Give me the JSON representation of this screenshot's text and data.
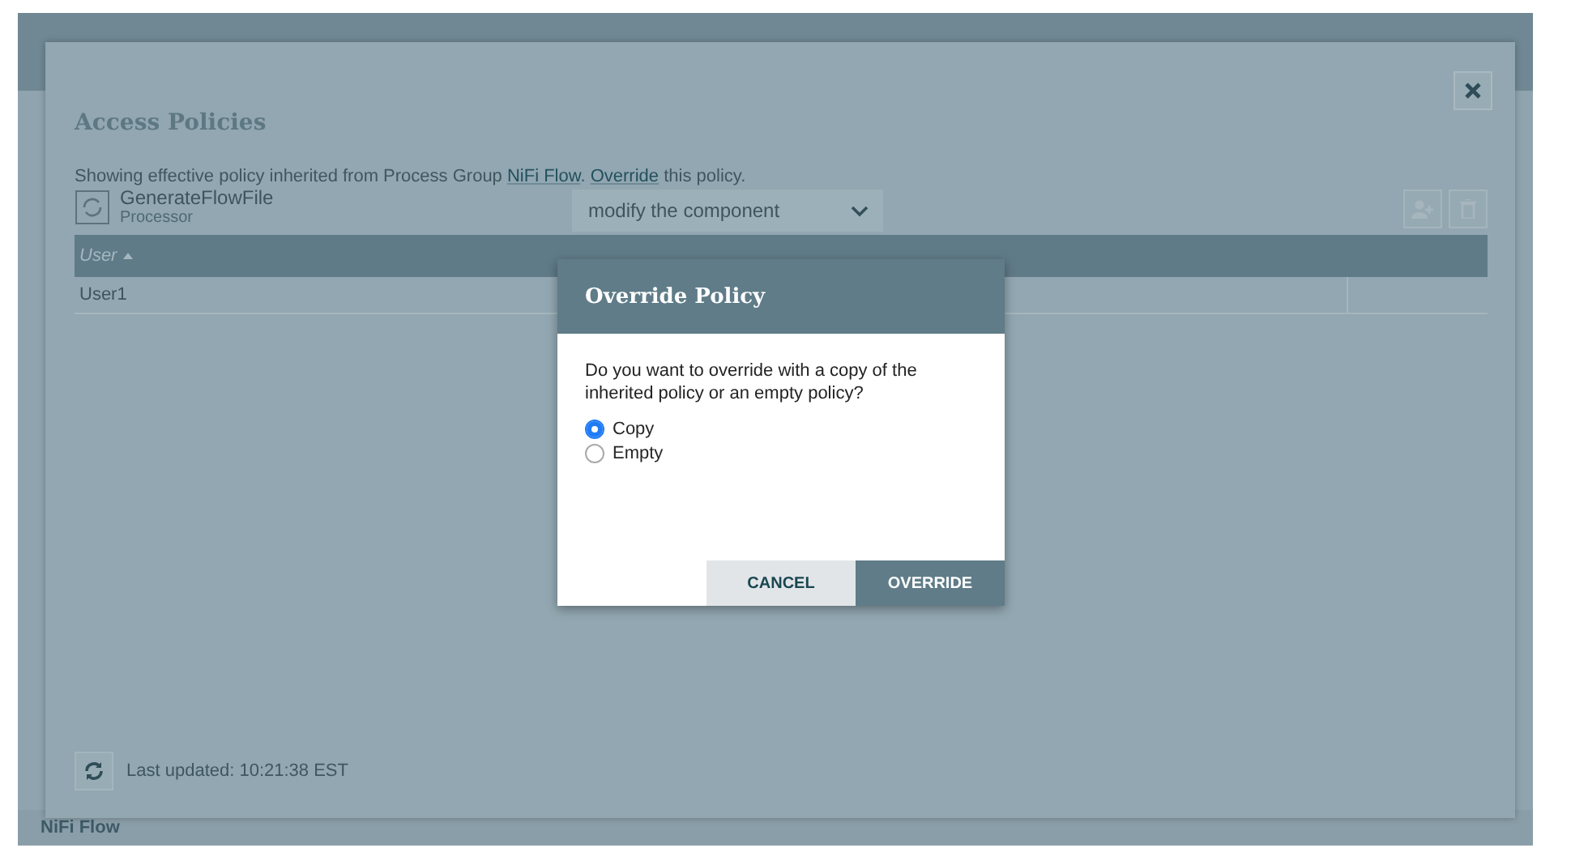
{
  "app": {
    "breadcrumb": "NiFi Flow"
  },
  "access_policies": {
    "title": "Access Policies",
    "notice": {
      "before": "Showing effective policy inherited from Process Group ",
      "group_link": "NiFi Flow",
      "middle": ". ",
      "override_link": "Override",
      "after": " this policy."
    },
    "component": {
      "name": "GenerateFlowFile",
      "type": "Processor"
    },
    "action": {
      "value": "modify the component"
    },
    "table": {
      "columns": [
        {
          "label": "User",
          "sort_ascending": true
        }
      ],
      "rows": [
        {
          "user": "User1"
        }
      ]
    },
    "last_updated": "Last updated: 10:21:38 EST"
  },
  "override_dialog": {
    "title": "Override Policy",
    "message": "Do you want to override with a copy of the inherited policy or an empty policy?",
    "options": [
      {
        "label": "Copy",
        "selected": true
      },
      {
        "label": "Empty",
        "selected": false
      }
    ],
    "buttons": [
      {
        "label": "CANCEL",
        "kind": "secondary"
      },
      {
        "label": "OVERRIDE",
        "kind": "primary"
      }
    ]
  }
}
